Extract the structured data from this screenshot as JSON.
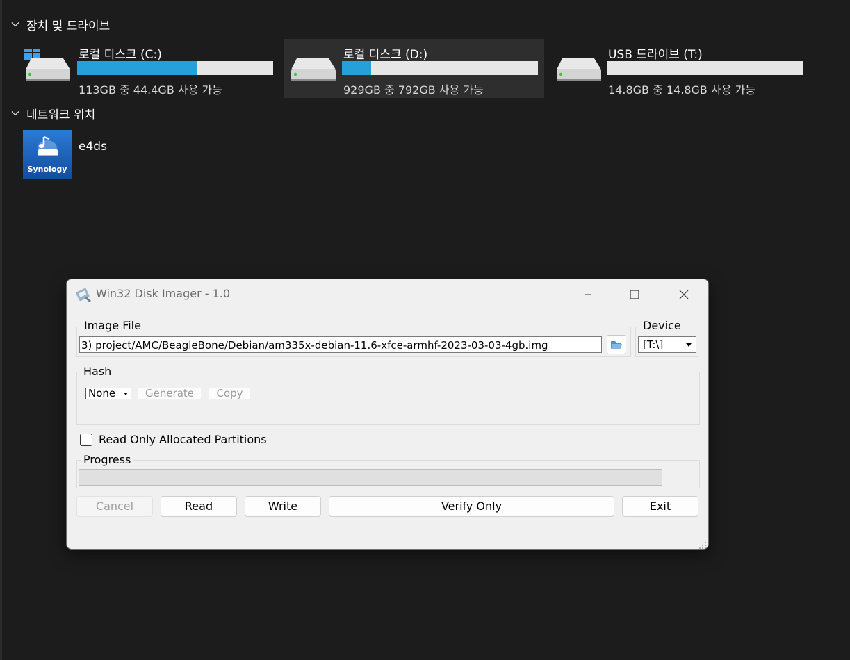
{
  "explorer": {
    "devices_header": "장치 및 드라이브",
    "network_header": "네트워크 위치",
    "drives": [
      {
        "name": "로컬 디스크 (C:)",
        "space": "113GB 중 44.4GB 사용 가능",
        "used_fraction": 0.61,
        "icon": "windows-drive-icon"
      },
      {
        "name": "로컬 디스크 (D:)",
        "space": "929GB 중 792GB 사용 가능",
        "used_fraction": 0.15,
        "icon": "hard-drive-icon"
      },
      {
        "name": "USB 드라이브 (T:)",
        "space": "14.8GB 중 14.8GB 사용 가능",
        "used_fraction": 0.0,
        "icon": "hard-drive-icon"
      }
    ],
    "network_locations": [
      {
        "name": "e4ds",
        "icon_text": "Synology",
        "icon": "synology-nas-icon"
      }
    ],
    "colors": {
      "background": "#1c1c1c",
      "usage_bar": "#26a0da",
      "bar_track": "#e6e6e6"
    }
  },
  "imager": {
    "title": "Win32 Disk Imager - 1.0",
    "image_file_label": "Image File",
    "image_file_path": "3) project/AMC/BeagleBone/Debian/am335x-debian-11.6-xfce-armhf-2023-03-03-4gb.img",
    "device_label": "Device",
    "device_value": "[T:\\]",
    "hash_label": "Hash",
    "hash_value": "None",
    "generate_label": "Generate",
    "copy_label": "Copy",
    "read_only_label": "Read Only Allocated Partitions",
    "read_only_checked": false,
    "progress_label": "Progress",
    "progress_value": 0,
    "buttons": {
      "cancel": "Cancel",
      "read": "Read",
      "write": "Write",
      "verify": "Verify Only",
      "exit": "Exit"
    }
  }
}
